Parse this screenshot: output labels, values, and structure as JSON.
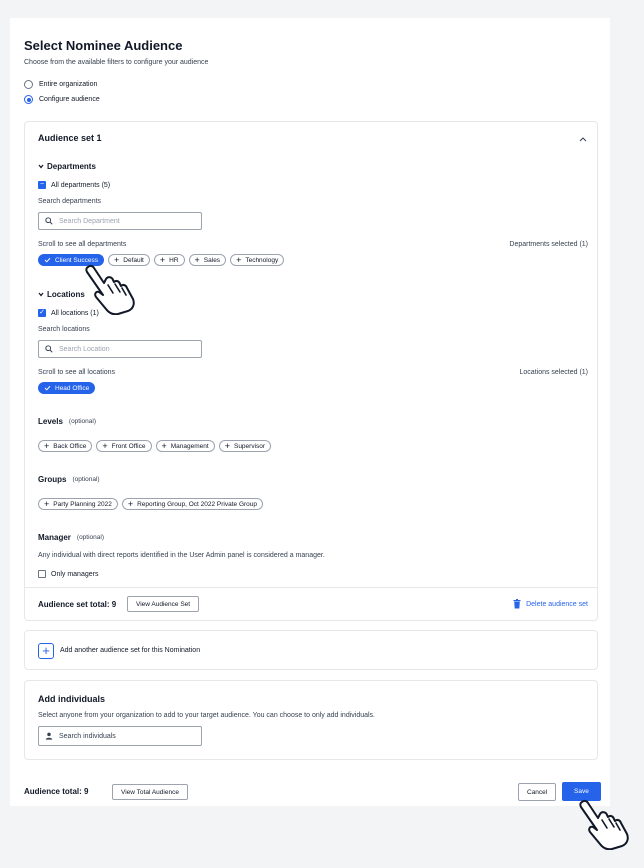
{
  "header": {
    "title": "Select Nominee Audience",
    "subtitle": "Choose from the available filters to configure your audience"
  },
  "audience_options": [
    {
      "label": "Entire organization",
      "selected": false
    },
    {
      "label": "Configure audience",
      "selected": true
    }
  ],
  "audience_set": {
    "title": "Audience set 1",
    "departments": {
      "heading": "Departments",
      "all_label": "All departments (5)",
      "search_label": "Search departments",
      "search_placeholder": "Search Department",
      "scroll_hint": "Scroll to see all departments",
      "selected_count": "Departments selected (1)",
      "chips": [
        {
          "label": "Client Success",
          "selected": true
        },
        {
          "label": "Default",
          "selected": false
        },
        {
          "label": "HR",
          "selected": false
        },
        {
          "label": "Sales",
          "selected": false
        },
        {
          "label": "Technology",
          "selected": false
        }
      ]
    },
    "locations": {
      "heading": "Locations",
      "all_label": "All locations (1)",
      "search_label": "Search locations",
      "search_placeholder": "Search Location",
      "scroll_hint": "Scroll to see all locations",
      "selected_count": "Locations selected (1)",
      "chips": [
        {
          "label": "Head Office",
          "selected": true
        }
      ]
    },
    "levels": {
      "heading": "Levels",
      "optional": "(optional)",
      "chips": [
        "Back Office",
        "Front Office",
        "Management",
        "Supervisor"
      ]
    },
    "groups": {
      "heading": "Groups",
      "optional": "(optional)",
      "chips": [
        "Party Planning 2022",
        "Reporting Group, Oct 2022 Private Group"
      ]
    },
    "manager": {
      "heading": "Manager",
      "optional": "(optional)",
      "description": "Any individual with direct reports identified in the User Admin panel is considered a manager.",
      "checkbox_label": "Only managers"
    },
    "total_label": "Audience set total: 9",
    "view_button": "View Audience Set",
    "delete_label": "Delete audience set"
  },
  "add_set": {
    "label": "Add another audience set for this Nomination"
  },
  "individuals": {
    "title": "Add individuals",
    "description": "Select anyone from your organization to add to your target audience. You can choose to only add individuals.",
    "search_placeholder": "Search individuals"
  },
  "footer": {
    "total_label": "Audience total: 9",
    "view_total_button": "View Total Audience",
    "cancel_button": "Cancel",
    "save_button": "Save"
  },
  "colors": {
    "accent": "#2563eb",
    "background": "#f3f4f6",
    "card": "#ffffff"
  },
  "icons": [
    "chevron-up-icon",
    "chevron-down-icon",
    "search-icon",
    "check-icon",
    "plus-icon",
    "trash-icon",
    "person-icon",
    "pointer-hand-icon"
  ]
}
